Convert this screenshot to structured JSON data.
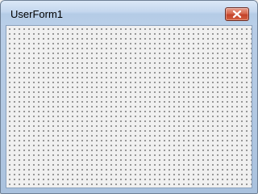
{
  "window": {
    "title": "UserForm1"
  },
  "titlebar": {
    "close_icon": "close-icon"
  },
  "colors": {
    "close_button": "#c4432a",
    "client_background": "#f0f0f0",
    "grid_dots": "#222222"
  }
}
